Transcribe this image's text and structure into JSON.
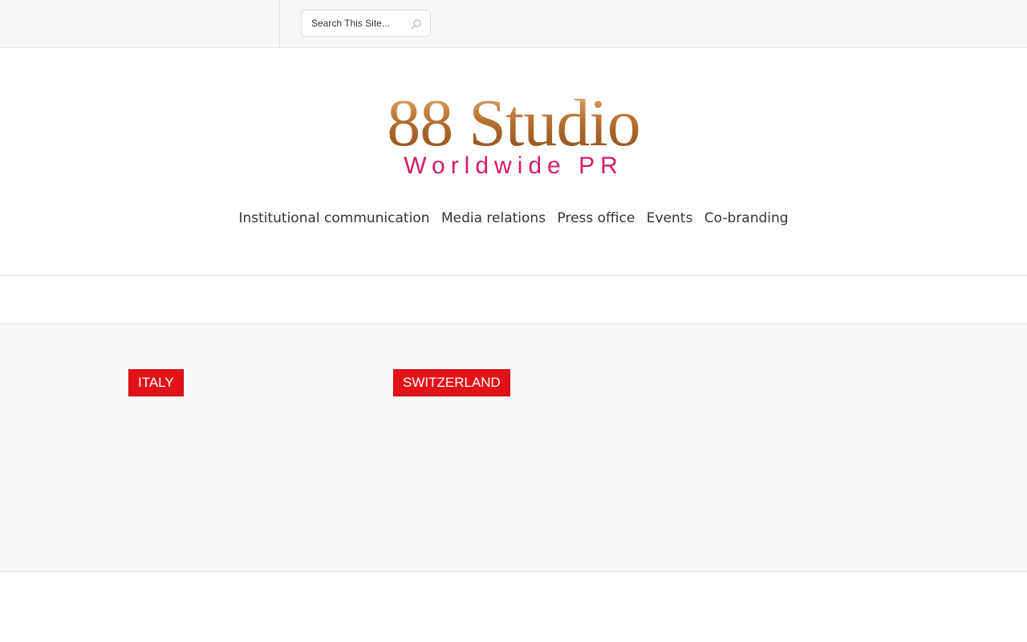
{
  "search": {
    "placeholder": "Search This Site..."
  },
  "logo": {
    "title": "88 Studio",
    "subtitle": "Worldwide PR",
    "title_color": "#b5712f",
    "subtitle_color": "#d61b6a"
  },
  "nav": {
    "items": [
      "Institutional communication",
      "Media relations",
      "Press office",
      "Events",
      "Co-branding"
    ]
  },
  "countries": {
    "items": [
      "ITALY",
      "SWITZERLAND"
    ],
    "color": "#e3121a"
  }
}
